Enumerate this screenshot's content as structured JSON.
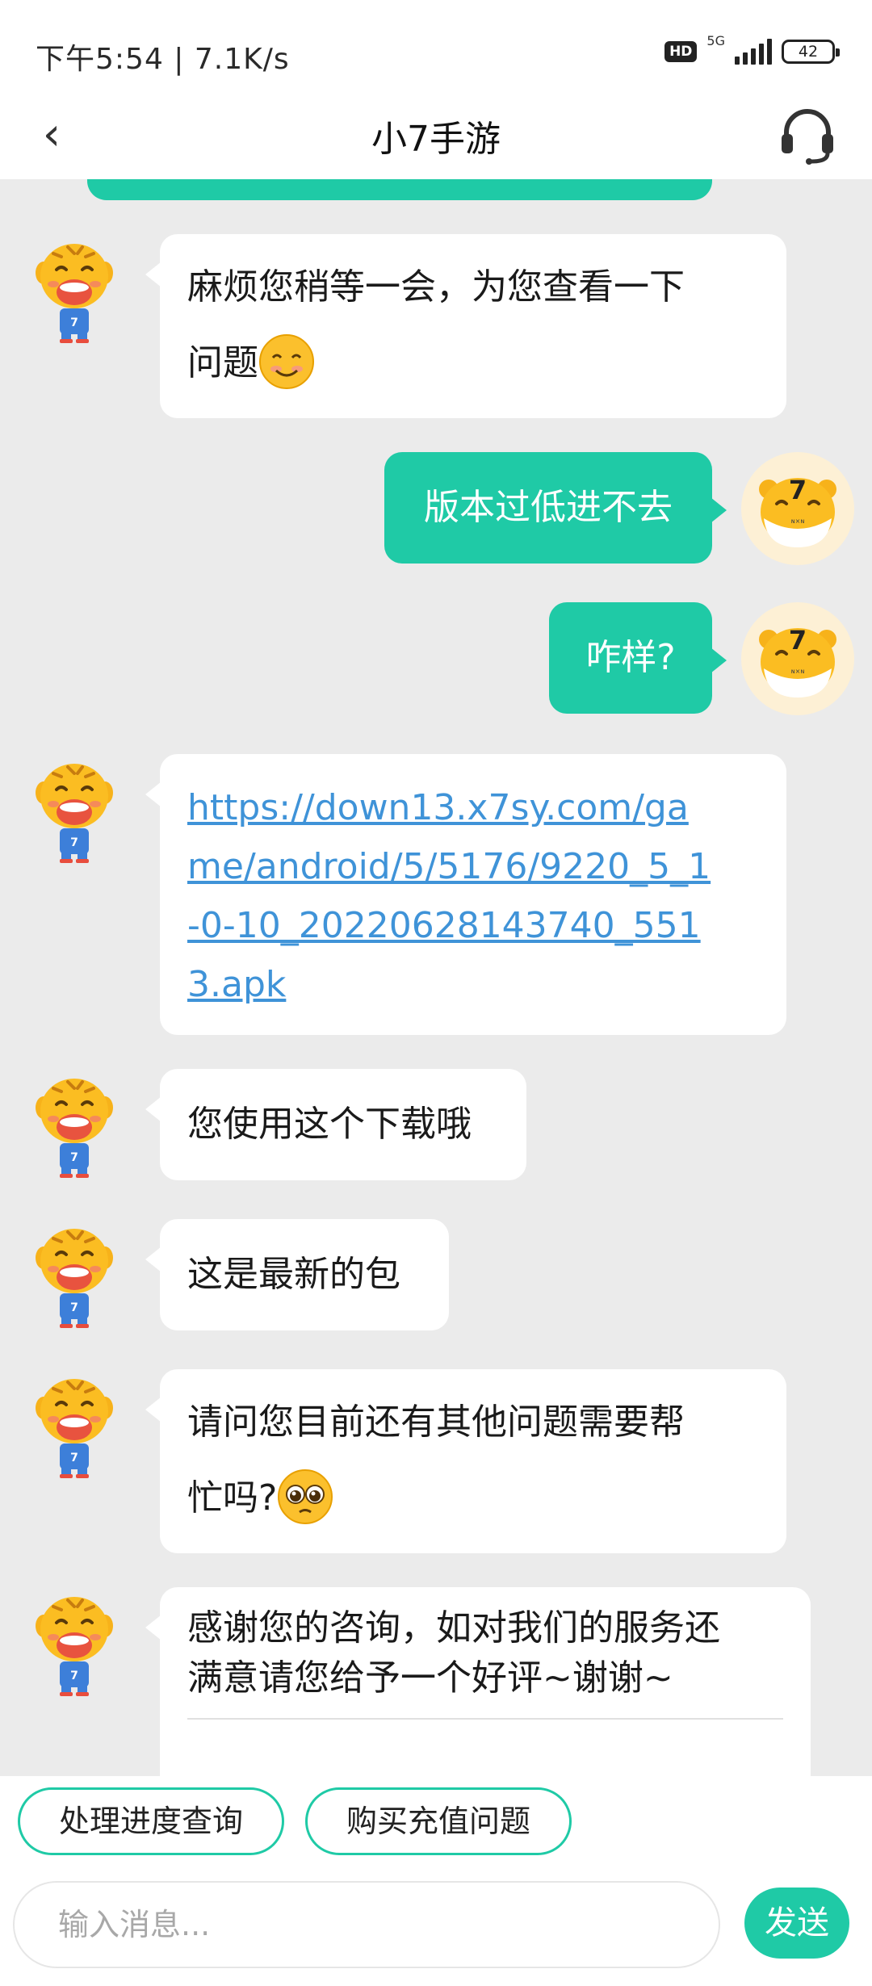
{
  "status_bar": {
    "time": "下午5:54 | 7.1K/s",
    "hd": "HD",
    "network": "5G",
    "battery": "42"
  },
  "header": {
    "back_icon": "‹",
    "title": "小7手游"
  },
  "messages": [
    {
      "side": "left",
      "text": "麻烦您稍等一会，为您查看一下",
      "text2": "问题",
      "emoji": "smile-emoji"
    },
    {
      "side": "right",
      "text": "版本过低进不去"
    },
    {
      "side": "right",
      "text": "咋样?"
    },
    {
      "side": "left",
      "type": "link",
      "text": "https://down13.x7sy.com/game/android/5/5176/9220_5_1-0-10_20220628143740_5513.apk"
    },
    {
      "side": "left",
      "text": "您使用这个下载哦"
    },
    {
      "side": "left",
      "text": "这是最新的包"
    },
    {
      "side": "left",
      "text": "请问您目前还有其他问题需要帮",
      "text2": "忙吗?",
      "emoji": "pleading-emoji"
    },
    {
      "side": "left",
      "text": "感谢您的咨询，如对我们的服务还",
      "text2": "满意请您给予一个好评~谢谢~"
    }
  ],
  "quick_replies": [
    "处理进度查询",
    "购买充值问题"
  ],
  "composer": {
    "placeholder": "输入消息...",
    "send_label": "发送"
  },
  "colors": {
    "accent": "#1fcaa6",
    "link": "#3f93d8",
    "background": "#ebebeb"
  }
}
